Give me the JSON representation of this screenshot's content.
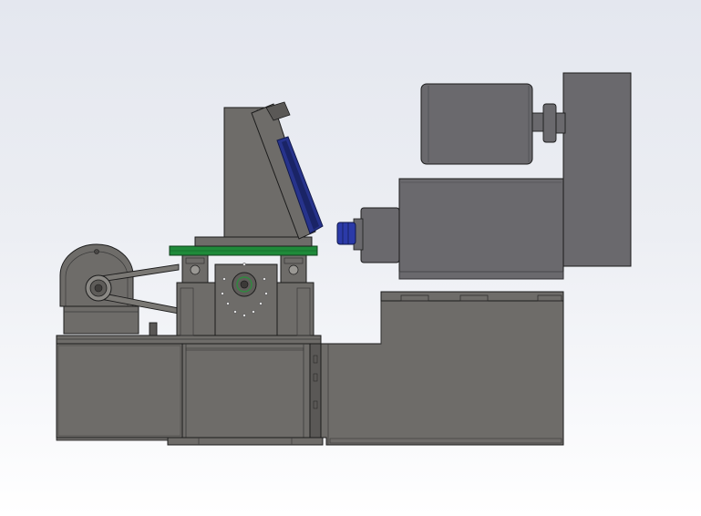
{
  "viewport": {
    "background_top": "#e4e7ef",
    "background_bottom": "#ffffff"
  },
  "colors": {
    "body_fill": "#6e6c69",
    "body_dark": "#5a5856",
    "motor_fill": "#6a696d",
    "outline": "#1c1c1c",
    "green_plate": "#1f8a3a",
    "blue_disc": "#27338c",
    "blue_disc_dark": "#1a2466",
    "blue_coupling": "#2b3aa8"
  }
}
